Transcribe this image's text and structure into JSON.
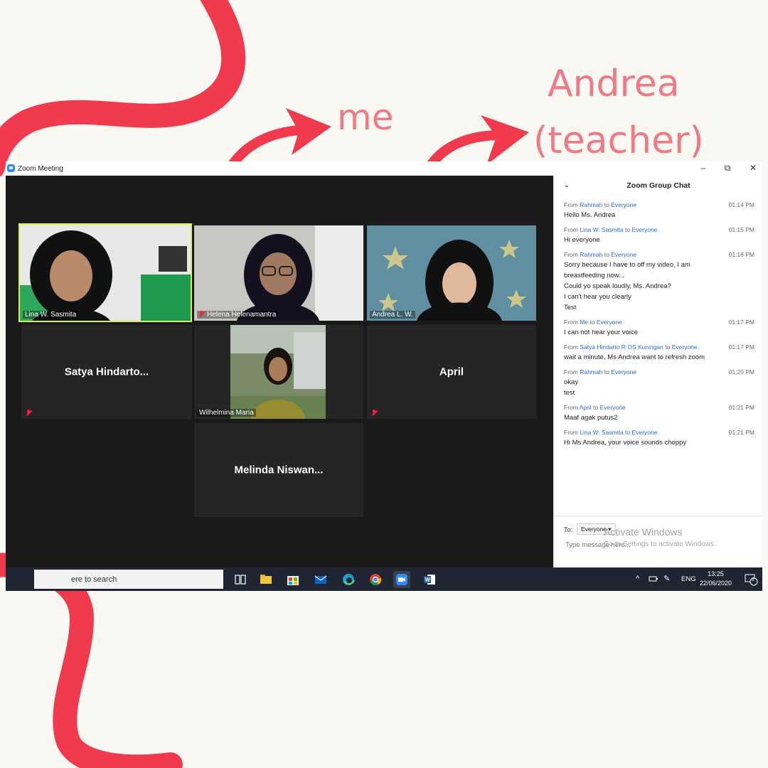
{
  "annotations": {
    "me": "me",
    "andrea_line1": "Andrea",
    "andrea_line2": "(teacher)"
  },
  "colors": {
    "accent_red": "#f23a4e",
    "annotation_pink": "#ef7a86",
    "zoom_blue": "#2d8cff"
  },
  "window": {
    "title": "Zoom Meeting",
    "controls": [
      "minimize-icon",
      "restore-icon",
      "close-icon"
    ]
  },
  "participants": [
    {
      "name": "Lina W. Sasmita",
      "video": true,
      "muted": false,
      "active": true
    },
    {
      "name": "Helena Helenamantra",
      "video": true,
      "muted": true
    },
    {
      "name": "Andrea L. W.",
      "video": true,
      "muted": false
    },
    {
      "name": "Satya  Hindarto...",
      "video": false,
      "muted": true
    },
    {
      "name": "Wilhelmina Maria",
      "video": true,
      "muted": false
    },
    {
      "name": "April",
      "video": false,
      "muted": true
    },
    {
      "name": "Melinda  Niswan...",
      "video": false,
      "muted": false
    }
  ],
  "chat": {
    "title": "Zoom Group Chat",
    "messages": [
      {
        "from": "Rahmah",
        "to": "Everyone",
        "time": "01:14 PM",
        "lines": [
          "Hello Ms. Andrea"
        ]
      },
      {
        "from": "Lina W. Sasmita",
        "to": "Everyone",
        "time": "01:15 PM",
        "lines": [
          "Hi everyone"
        ]
      },
      {
        "from": "Rahmah",
        "to": "Everyone",
        "time": "01:16 PM",
        "lines": [
          "Sorry because I have to off my video, I am",
          "breastfeeding now...",
          "Could yo speak loudly, Ms. Andrea?",
          "I can't hear you clearly",
          "Test"
        ]
      },
      {
        "from": "Me",
        "to": "Everyone",
        "time": "01:17 PM",
        "lines": [
          "I can not hear your voice"
        ]
      },
      {
        "from": "Satya Hindarto R OS Kuningan",
        "to": "Everyone",
        "time": "01:17 PM",
        "lines": [
          "wait a minute, Ms Andrea want to refresh zoom"
        ]
      },
      {
        "from": "Rahmah",
        "to": "Everyone",
        "time": "01:20 PM",
        "lines": [
          "okay",
          "test"
        ]
      },
      {
        "from": "April",
        "to": "Everyone",
        "time": "01:21 PM",
        "lines": [
          "Maaf agak putus2"
        ]
      },
      {
        "from": "Lina W. Sasmita",
        "to": "Everyone",
        "time": "01:21 PM",
        "lines": [
          "Hi Ms Andrea, your voice sounds choppy"
        ]
      }
    ],
    "from_word": "From",
    "to_word": "to",
    "to_label": "To:",
    "recipient": "Everyone",
    "input_placeholder": "Type message here...",
    "activate_title": "Activate Windows",
    "activate_sub": "Go to Settings to activate Windows."
  },
  "taskbar": {
    "search_text": "ere to search",
    "tray_lang": "ENG",
    "time": "13:25",
    "date": "22/06/2020",
    "notification_count": "2"
  }
}
